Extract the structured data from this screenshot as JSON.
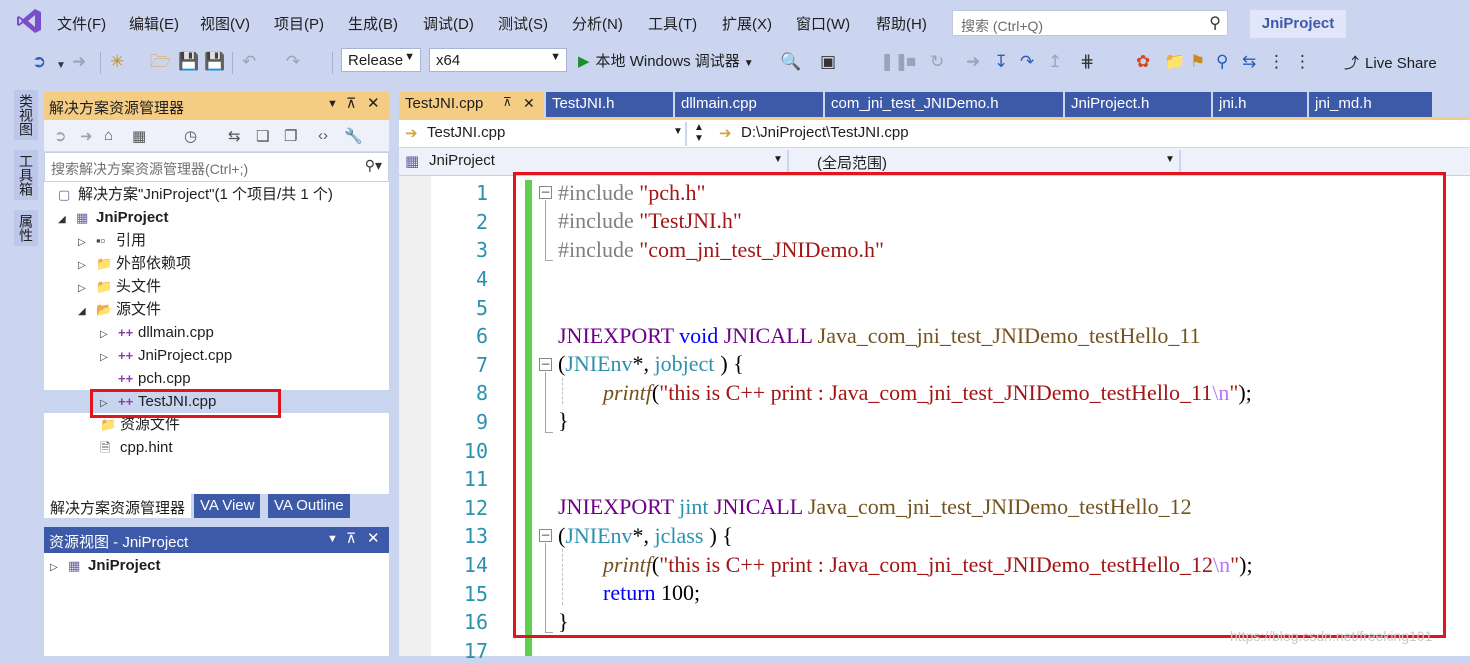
{
  "menu": [
    "文件(F)",
    "编辑(E)",
    "视图(V)",
    "项目(P)",
    "生成(B)",
    "调试(D)",
    "测试(S)",
    "分析(N)",
    "工具(T)",
    "扩展(X)",
    "窗口(W)",
    "帮助(H)"
  ],
  "search": {
    "placeholder": "搜索 (Ctrl+Q)"
  },
  "project_title": "JniProject",
  "toolbar": {
    "config": "Release",
    "platform": "x64",
    "run_label": "本地 Windows 调试器",
    "live_share": "Live Share"
  },
  "side_tabs": [
    "类视图",
    "工具箱",
    "属性"
  ],
  "solution_explorer": {
    "title": "解决方案资源管理器",
    "search_placeholder": "搜索解决方案资源管理器(Ctrl+;)",
    "tree": [
      {
        "label": "解决方案\"JniProject\"(1 个项目/共 1 个)"
      },
      {
        "label": "JniProject"
      },
      {
        "label": "引用"
      },
      {
        "label": "外部依赖项"
      },
      {
        "label": "头文件"
      },
      {
        "label": "源文件"
      },
      {
        "label": "dllmain.cpp"
      },
      {
        "label": "JniProject.cpp"
      },
      {
        "label": "pch.cpp"
      },
      {
        "label": "TestJNI.cpp"
      },
      {
        "label": "资源文件"
      },
      {
        "label": "cpp.hint"
      }
    ],
    "bottom_tabs": [
      "解决方案资源管理器",
      "VA View",
      "VA Outline"
    ]
  },
  "resource_view": {
    "title": "资源视图 - JniProject",
    "root": "JniProject"
  },
  "doc_tabs": [
    "TestJNI.cpp",
    "TestJNI.h",
    "dllmain.cpp",
    "com_jni_test_JNIDemo.h",
    "JniProject.h",
    "jni.h",
    "jni_md.h"
  ],
  "navbar": {
    "file": "TestJNI.cpp",
    "path": "D:\\JniProject\\TestJNI.cpp",
    "project": "JniProject",
    "scope": "(全局范围)"
  },
  "code": {
    "line_numbers": [
      "1",
      "2",
      "3",
      "4",
      "5",
      "6",
      "7",
      "8",
      "9",
      "10",
      "11",
      "12",
      "13",
      "14",
      "15",
      "16",
      "17"
    ],
    "include": "#include",
    "inc1": "\"pch.h\"",
    "inc2": "\"TestJNI.h\"",
    "inc3": "\"com_jni_test_JNIDemo.h\"",
    "jniexport": "JNIEXPORT",
    "void": "void",
    "jint": "jint",
    "jnicall": "JNICALL",
    "fn1": "Java_com_jni_test_JNIDemo_testHello_11",
    "fn2": "Java_com_jni_test_JNIDemo_testHello_12",
    "open_paren": "(",
    "jnienv": "JNIEnv",
    "star_comma": "*, ",
    "jobject": "jobject",
    "jclass": "jclass",
    "close_brace_open": ") {",
    "printf": "printf",
    "str1": "\"this is C++ print : Java_com_jni_test_JNIDemo_testHello_11",
    "str2": "\"this is C++ print : Java_com_jni_test_JNIDemo_testHello_12",
    "esc": "\\n",
    "quote_end": "\"",
    "paren_semi": ");",
    "return": "return",
    "ret_val": "100",
    "semi": ";",
    "close": "}"
  },
  "watermark": "https://blog.csdn.net/freeking101"
}
